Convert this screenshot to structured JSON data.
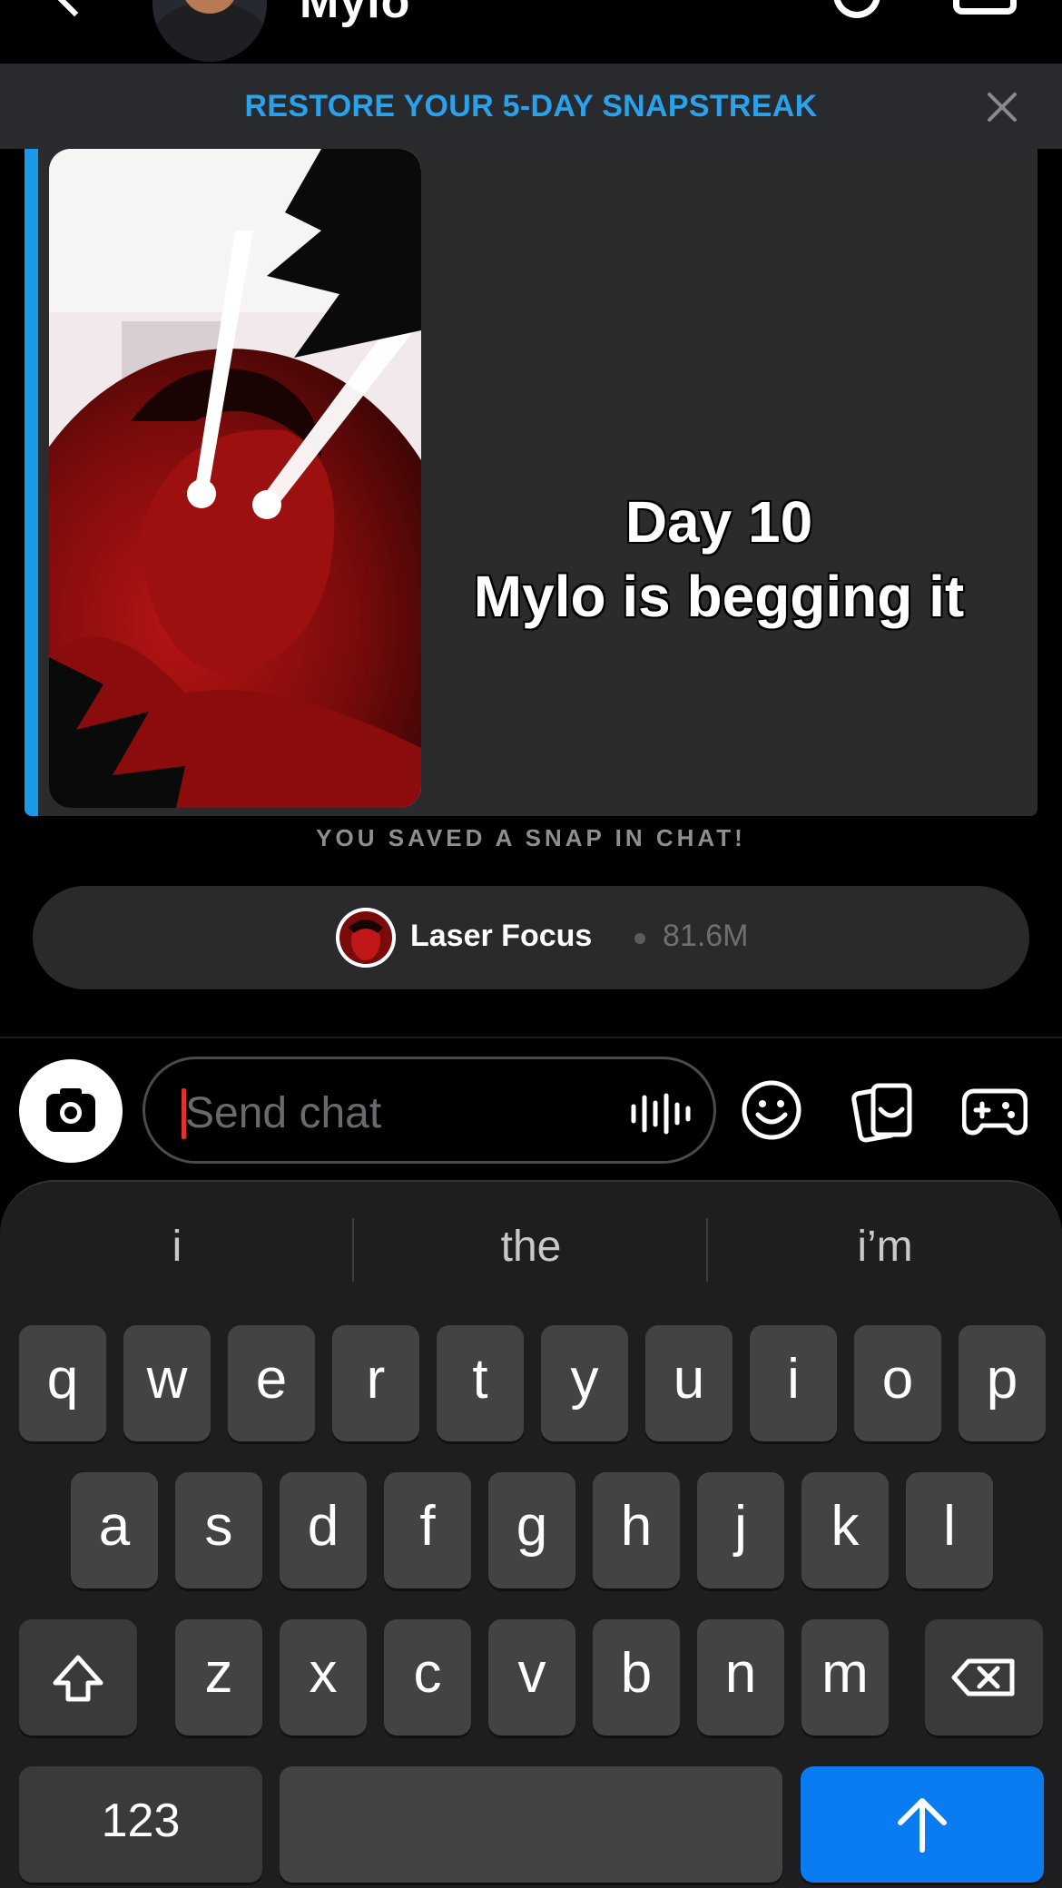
{
  "header": {
    "contact_name": "Mylo"
  },
  "banner": {
    "text": "RESTORE YOUR 5-DAY SNAPSTREAK"
  },
  "snap": {
    "caption_line1": "Day 10",
    "caption_line2": "Mylo is begging it",
    "accent_color": "#1a9be8"
  },
  "saved_notice": "YOU SAVED A SNAP IN CHAT!",
  "lens": {
    "name": "Laser Focus",
    "count": "81.6M"
  },
  "chat_bar": {
    "placeholder": "Send chat",
    "icons": [
      "camera-icon",
      "voice-icon",
      "emoji-icon",
      "sticker-icon",
      "game-icon"
    ]
  },
  "keyboard": {
    "suggestions": [
      "i",
      "the",
      "i’m"
    ],
    "row1": [
      "q",
      "w",
      "e",
      "r",
      "t",
      "y",
      "u",
      "i",
      "o",
      "p"
    ],
    "row2": [
      "a",
      "s",
      "d",
      "f",
      "g",
      "h",
      "j",
      "k",
      "l"
    ],
    "row3": [
      "z",
      "x",
      "c",
      "v",
      "b",
      "n",
      "m"
    ],
    "numbers_label": "123",
    "send_color": "#0a7cf2"
  }
}
